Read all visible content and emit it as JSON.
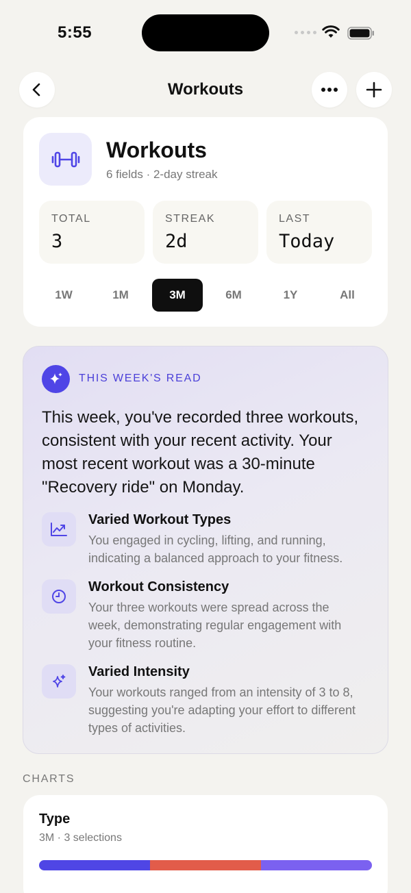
{
  "status": {
    "time": "5:55"
  },
  "nav": {
    "title": "Workouts"
  },
  "header": {
    "title": "Workouts",
    "subtitle": "6 fields · 2-day streak",
    "stats": [
      {
        "label": "TOTAL",
        "value": "3"
      },
      {
        "label": "STREAK",
        "value": "2d"
      },
      {
        "label": "LAST",
        "value": "Today"
      }
    ],
    "ranges": [
      "1W",
      "1M",
      "3M",
      "6M",
      "1Y",
      "All"
    ],
    "selected_range": "3M"
  },
  "insight": {
    "label": "THIS WEEK'S READ",
    "body": "This week, you've recorded three workouts, consistent with your recent activity. Your most recent workout was a 30-minute \"Recovery ride\" on Monday.",
    "items": [
      {
        "title": "Varied Workout Types",
        "desc": "You engaged in cycling, lifting, and running, indicating a balanced approach to your fitness.",
        "icon": "trend-up-icon"
      },
      {
        "title": "Workout Consistency",
        "desc": "Your three workouts were spread across the week, demonstrating regular engagement with your fitness routine.",
        "icon": "clock-icon"
      },
      {
        "title": "Varied Intensity",
        "desc": "Your workouts ranged from an intensity of 3 to 8, suggesting you're adapting your effort to different types of activities.",
        "icon": "sparkle-icon"
      }
    ]
  },
  "charts": {
    "section_label": "CHARTS",
    "type_card": {
      "title": "Type",
      "subtitle": "3M · 3 selections",
      "segments": [
        {
          "fraction": 0.333,
          "color": "#4f46e5"
        },
        {
          "fraction": 0.334,
          "color": "#e25c4a"
        },
        {
          "fraction": 0.333,
          "color": "#7b61f0"
        }
      ]
    }
  },
  "colors": {
    "accent": "#4f45e6",
    "background": "#f4f3ef"
  }
}
